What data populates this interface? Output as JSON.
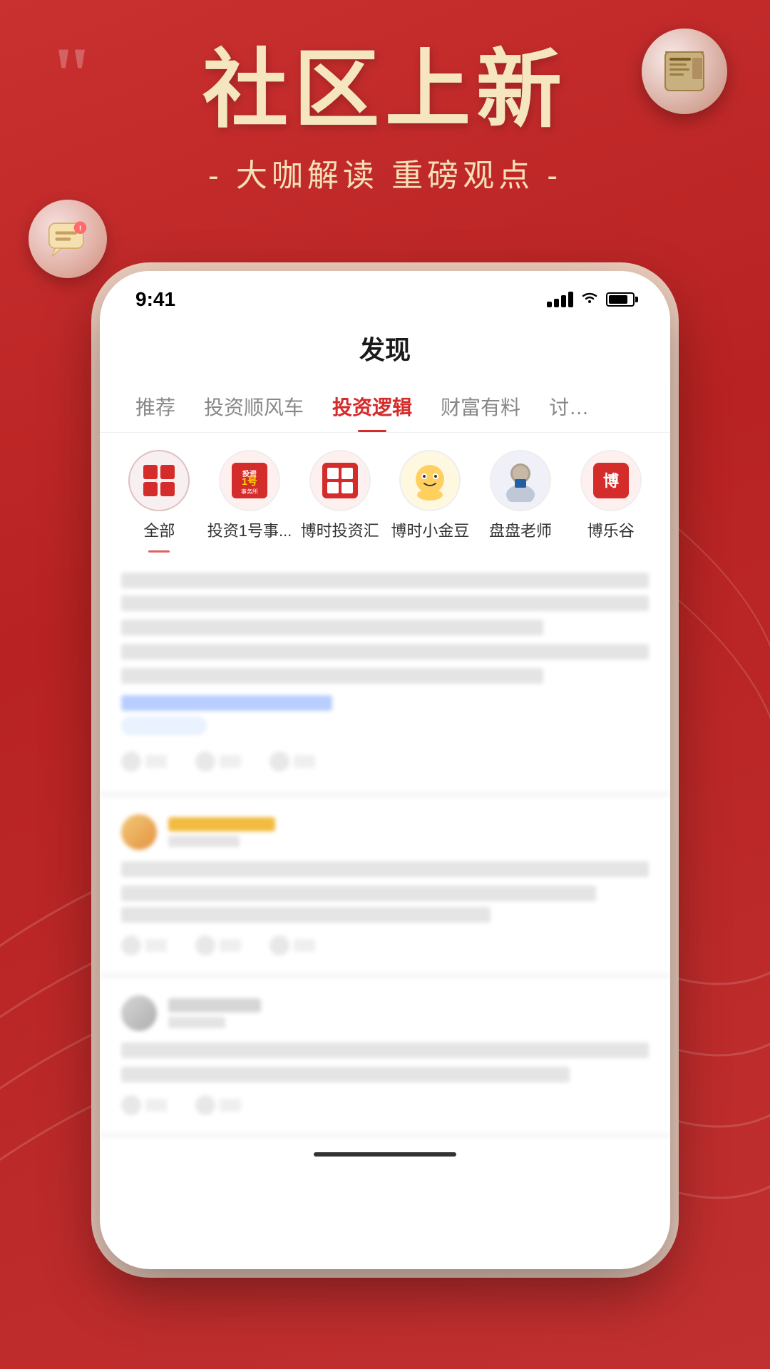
{
  "background": {
    "color": "#c0292a"
  },
  "hero": {
    "title": "社区上新",
    "subtitle": "- 大咖解读 重磅观点 -",
    "quote_mark": "““"
  },
  "phone": {
    "status_bar": {
      "time": "9:41"
    },
    "header": {
      "title": "发现"
    },
    "tabs": [
      {
        "label": "推荐",
        "active": false
      },
      {
        "label": "投资顺风车",
        "active": false
      },
      {
        "label": "投资逻辑",
        "active": true
      },
      {
        "label": "财富有料",
        "active": false
      },
      {
        "label": "讨论",
        "active": false
      }
    ],
    "categories": [
      {
        "label": "全部",
        "selected": true,
        "icon_type": "grid"
      },
      {
        "label": "投资1号事...",
        "selected": false,
        "icon_type": "news1"
      },
      {
        "label": "博时投资汇",
        "selected": false,
        "icon_type": "news2"
      },
      {
        "label": "博时小金豆",
        "selected": false,
        "icon_type": "robot"
      },
      {
        "label": "盘盘老师",
        "selected": false,
        "icon_type": "person"
      },
      {
        "label": "博乐谷",
        "selected": false,
        "icon_type": "text"
      }
    ]
  }
}
